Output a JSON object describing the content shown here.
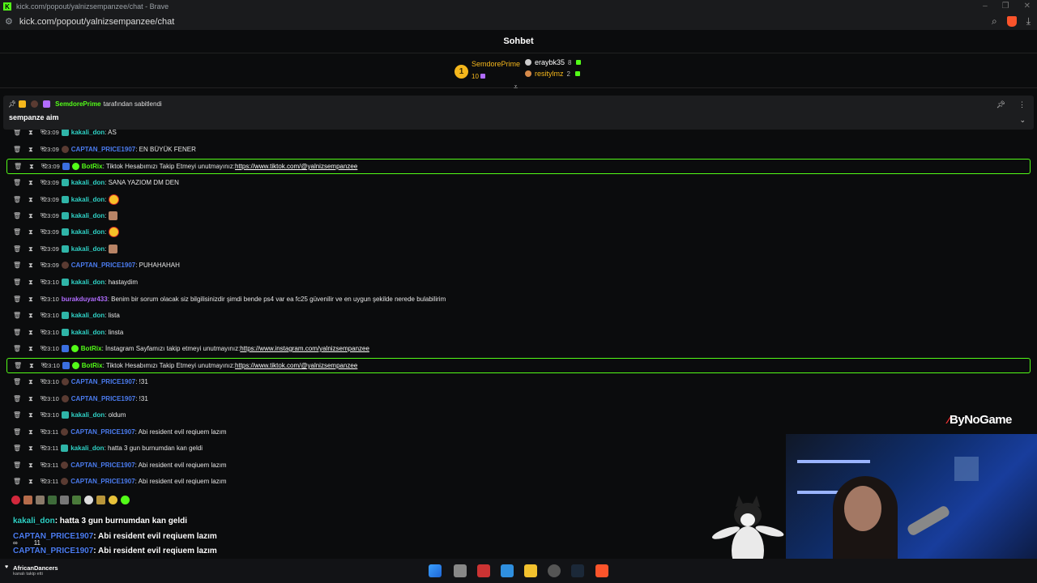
{
  "browser": {
    "title": "kick.com/popout/yalnizsempanzee/chat - Brave",
    "url": "kick.com/popout/yalnizsempanzee/chat"
  },
  "chat_header": {
    "title": "Sohbet"
  },
  "leaderboard": {
    "first": {
      "rank": "1",
      "name": "SemdorePrime",
      "count": "10"
    },
    "second": {
      "name": "eraybk35",
      "count": "8"
    },
    "third": {
      "name": "resitylmz",
      "count": "2"
    }
  },
  "pinned": {
    "by_name": "SemdorePrime",
    "by_suffix": "tarafından sabitlendi",
    "message": "sempanze aim"
  },
  "messages": [
    {
      "time": "23:09",
      "user": "kakali_don",
      "text": ": AS"
    },
    {
      "time": "23:09",
      "user": "CAPTAN_PRICE1907",
      "text": ": EN BÜYÜK FENER"
    },
    {
      "time": "23:09",
      "user": "BotRix",
      "text": ": Tiktok Hesabımızı Takip Etmeyi unutmayınız: ",
      "link": "https://www.tiktok.com/@yalnizsempanzee"
    },
    {
      "time": "23:09",
      "user": "kakali_don",
      "text": ": SANA YAZIOM DM DEN"
    },
    {
      "time": "23:09",
      "user": "kakali_don",
      "text": ":"
    },
    {
      "time": "23:09",
      "user": "kakali_don",
      "text": ":"
    },
    {
      "time": "23:09",
      "user": "kakali_don",
      "text": ":"
    },
    {
      "time": "23:09",
      "user": "kakali_don",
      "text": ":"
    },
    {
      "time": "23:09",
      "user": "CAPTAN_PRICE1907",
      "text": ": PUHAHAHAH"
    },
    {
      "time": "23:10",
      "user": "kakali_don",
      "text": ": hastaydim"
    },
    {
      "time": "23:10",
      "user": "burakduyar433",
      "text": ": Benim bir sorum olacak siz bilgilisinizdir şimdi bende ps4 var ea fc25 güvenilir ve en uygun şekilde nerede bulabilirim"
    },
    {
      "time": "23:10",
      "user": "kakali_don",
      "text": ": lista"
    },
    {
      "time": "23:10",
      "user": "kakali_don",
      "text": ": linsta"
    },
    {
      "time": "23:10",
      "user": "BotRix",
      "text": ": İnstagram Sayfamızı takip etmeyi unutmayınız: ",
      "link": "https://www.instagram.com/yalnizsempanzee"
    },
    {
      "time": "23:10",
      "user": "BotRix",
      "text": ": Tiktok Hesabımızı Takip Etmeyi unutmayınız: ",
      "link": "https://www.tiktok.com/@yalnizsempanzee"
    },
    {
      "time": "23:10",
      "user": "CAPTAN_PRICE1907",
      "text": ": !31"
    },
    {
      "time": "23:10",
      "user": "CAPTAN_PRICE1907",
      "text": ": !31"
    },
    {
      "time": "23:10",
      "user": "kakali_don",
      "text": ": oldum"
    },
    {
      "time": "23:11",
      "user": "CAPTAN_PRICE1907",
      "text": ": Abi resident evil reqiuem lazım"
    },
    {
      "time": "23:11",
      "user": "kakali_don",
      "text": ": hatta 3 gun burnumdan kan geldi"
    },
    {
      "time": "23:11",
      "user": "CAPTAN_PRICE1907",
      "text": ": Abi resident evil reqiuem lazım"
    },
    {
      "time": "23:11",
      "user": "CAPTAN_PRICE1907",
      "text": ": Abi resident evil reqiuem lazım"
    }
  ],
  "overlay": {
    "line1_user": "kakali_don",
    "line1_text": ": hatta 3 gun burnumdan kan geldi",
    "line2_user": "CAPTAN_PRICE1907",
    "line2_text": ": Abi resident evil reqiuem lazım",
    "line3_user": "CAPTAN_PRICE1907",
    "line3_text": ": Abi resident evil reqiuem lazım",
    "stat1": "∞",
    "stat2": "11"
  },
  "stream_logo": "ByNoGame",
  "follower_alert": {
    "name": "AfricanDancers",
    "text": "kanalı takip etti"
  },
  "colors": {
    "accent": "#53fc18",
    "kakali": "#2fd1c5",
    "captain": "#4b7cf0",
    "burak": "#b16cff",
    "gold": "#f5b71c"
  }
}
